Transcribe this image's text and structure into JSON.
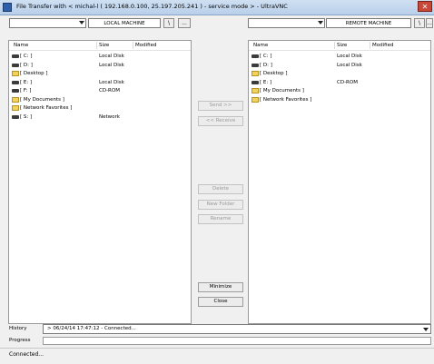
{
  "window": {
    "title": "File Transfer with < michal-l ( 192.168.0.100, 25.197.205.241 ) - service mode >  -  UltraVNC",
    "close_glyph": "✕"
  },
  "local": {
    "drive_selected": "",
    "label": "LOCAL MACHINE",
    "up_glyph": "\\",
    "more_glyph": "...",
    "columns": {
      "name": "Name",
      "size": "Size",
      "modified": "Modified"
    },
    "items": [
      {
        "name": "[ C: ]",
        "size": "Local Disk",
        "icon": "drive-icon"
      },
      {
        "name": "[ D: ]",
        "size": "Local Disk",
        "icon": "drive-icon"
      },
      {
        "name": "[ Desktop ]",
        "size": "",
        "icon": "folder-icon"
      },
      {
        "name": "[ E: ]",
        "size": "Local Disk",
        "icon": "drive-icon"
      },
      {
        "name": "[ F: ]",
        "size": "CD-ROM",
        "icon": "drive-icon"
      },
      {
        "name": "[ My Documents ]",
        "size": "",
        "icon": "folder-icon"
      },
      {
        "name": "[ Network Favorites ]",
        "size": "",
        "icon": "folder-icon"
      },
      {
        "name": "[ S: ]",
        "size": "Network",
        "icon": "drive-icon"
      }
    ]
  },
  "remote": {
    "drive_selected": "",
    "label": "REMOTE MACHINE",
    "up_glyph": "\\",
    "more_glyph": "...",
    "columns": {
      "name": "Name",
      "size": "Size",
      "modified": "Modified"
    },
    "items": [
      {
        "name": "[ C: ]",
        "size": "Local Disk",
        "icon": "drive-icon"
      },
      {
        "name": "[ D: ]",
        "size": "Local Disk",
        "icon": "drive-icon"
      },
      {
        "name": "[ Desktop ]",
        "size": "",
        "icon": "folder-icon"
      },
      {
        "name": "[ E: ]",
        "size": "CD-ROM",
        "icon": "drive-icon"
      },
      {
        "name": "[ My Documents ]",
        "size": "",
        "icon": "folder-icon"
      },
      {
        "name": "[ Network Favorites ]",
        "size": "",
        "icon": "folder-icon"
      }
    ]
  },
  "actions": {
    "send": "Send >>",
    "receive": "<< Receive",
    "delete": "Delete",
    "new_folder": "New Folder",
    "rename": "Rename",
    "minimize": "Minimize",
    "close": "Close"
  },
  "history": {
    "label": "History",
    "value": "> 06/24/14 17:47:12 - Connected..."
  },
  "progress": {
    "label": "Progress",
    "fraction": 0
  },
  "status": {
    "text": "Connected..."
  },
  "colors": {
    "titlebar": "#cfe0f2",
    "folder": "#f3d25b",
    "progress_fill": "#6fcf5a"
  }
}
